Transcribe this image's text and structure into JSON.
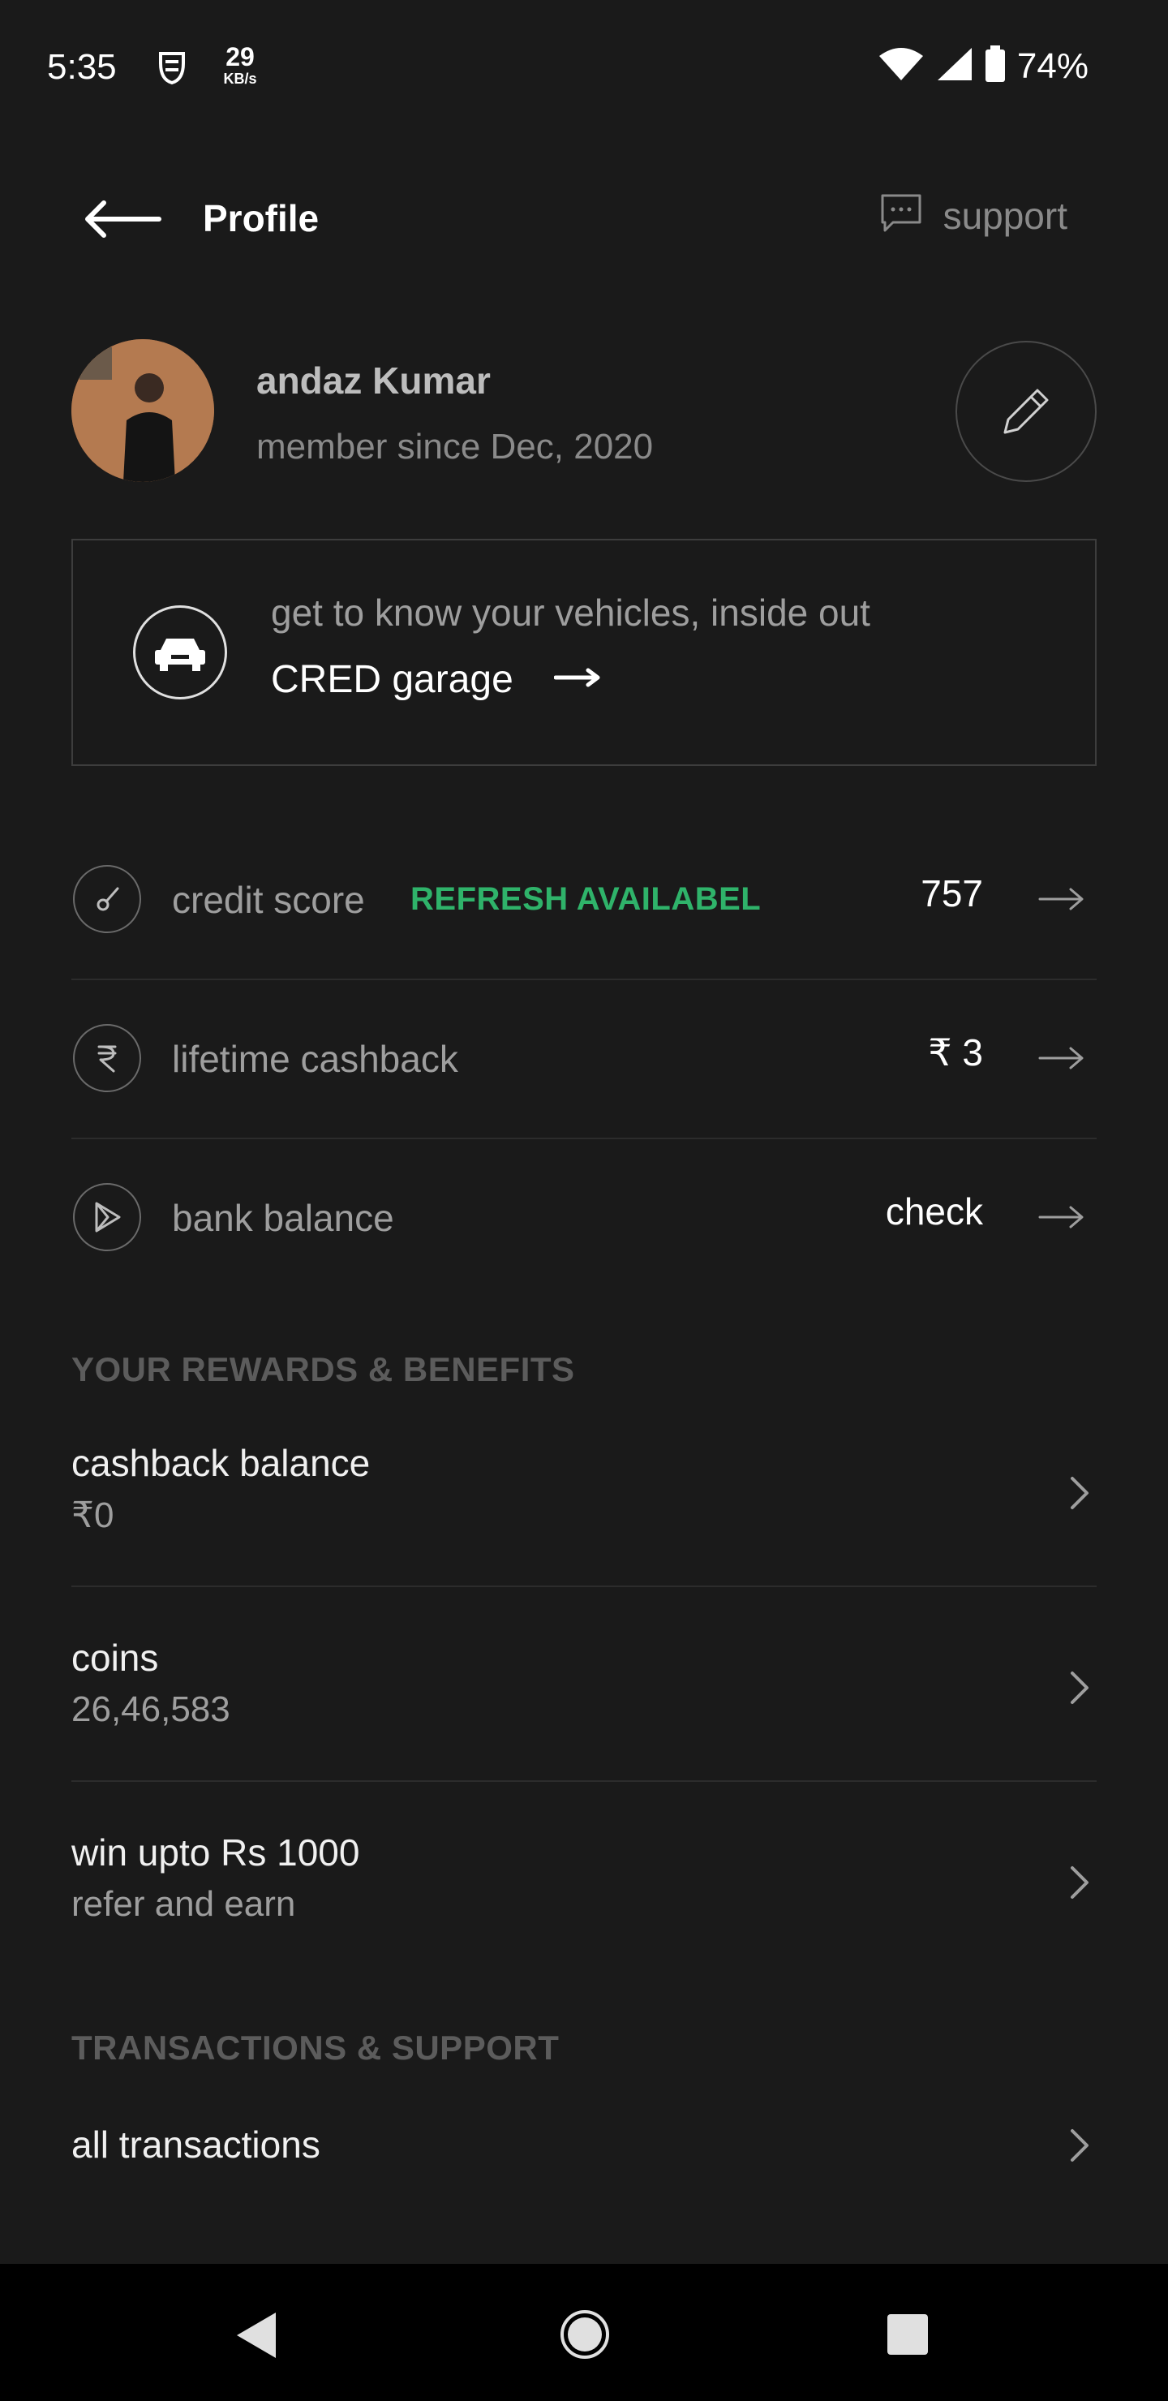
{
  "status_bar": {
    "time": "5:35",
    "net_speed_value": "29",
    "net_speed_unit": "KB/s",
    "battery": "74%"
  },
  "header": {
    "title": "Profile",
    "support_label": "support"
  },
  "profile": {
    "name": "andaz Kumar",
    "member_since": "member since Dec, 2020"
  },
  "garage": {
    "subtitle": "get to know your vehicles, inside out",
    "title": "CRED garage"
  },
  "stats": [
    {
      "label": "credit score",
      "badge": "REFRESH AVAILABEL",
      "value": "757",
      "icon": "gauge-icon"
    },
    {
      "label": "lifetime cashback",
      "value": "₹ 3",
      "icon": "rupee-icon"
    },
    {
      "label": "bank balance",
      "value": "check",
      "icon": "bank-balance-icon"
    }
  ],
  "rewards": {
    "header": "YOUR REWARDS & BENEFITS",
    "items": [
      {
        "title": "cashback balance",
        "subtitle": "₹0"
      },
      {
        "title": "coins",
        "subtitle": "26,46,583"
      },
      {
        "title": "win upto Rs 1000",
        "subtitle": "refer and earn"
      }
    ]
  },
  "transactions": {
    "header": "TRANSACTIONS & SUPPORT",
    "items": [
      {
        "title": "all transactions"
      }
    ]
  },
  "colors": {
    "background": "#1a1a1a",
    "accent_green": "#2fb36a",
    "nav_bar": "#000000"
  }
}
